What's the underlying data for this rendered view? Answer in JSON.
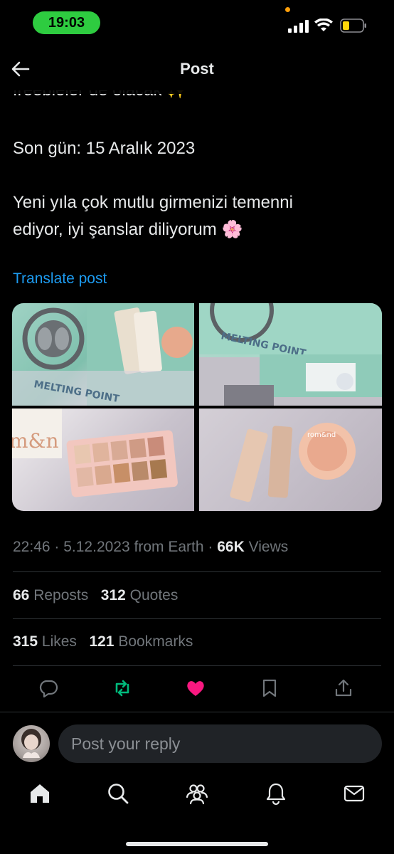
{
  "status_bar": {
    "time": "19:03"
  },
  "header": {
    "title": "Post"
  },
  "post": {
    "cut_off_line": "freebieler de olacak ✨",
    "deadline": "Son gün: 15 Aralık 2023",
    "line1": "Yeni yıla çok mutlu girmenizi temenni",
    "line2": "ediyor, iyi şanslar diliyorum 🌸",
    "translate_label": "Translate post",
    "media": {
      "image1_text": "MELTING POINT",
      "image2_text": "MELTING POINT",
      "image3_text": "m&n",
      "image4_text": "rom&nd"
    },
    "time": "22:46",
    "date": "5.12.2023",
    "source": "from Earth",
    "views_count": "66K",
    "views_label": "Views",
    "reposts_count": "66",
    "reposts_label": "Reposts",
    "quotes_count": "312",
    "quotes_label": "Quotes",
    "likes_count": "315",
    "likes_label": "Likes",
    "bookmarks_count": "121",
    "bookmarks_label": "Bookmarks"
  },
  "actions": {
    "icons": [
      "reply-icon",
      "repost-icon",
      "like-icon",
      "bookmark-icon",
      "share-icon"
    ],
    "repost_color": "#00ba7c",
    "like_color": "#f91880"
  },
  "reply": {
    "placeholder": "Post your reply"
  },
  "tabbar": {
    "icons": [
      "home-icon",
      "search-icon",
      "communities-icon",
      "notifications-icon",
      "messages-icon"
    ]
  }
}
